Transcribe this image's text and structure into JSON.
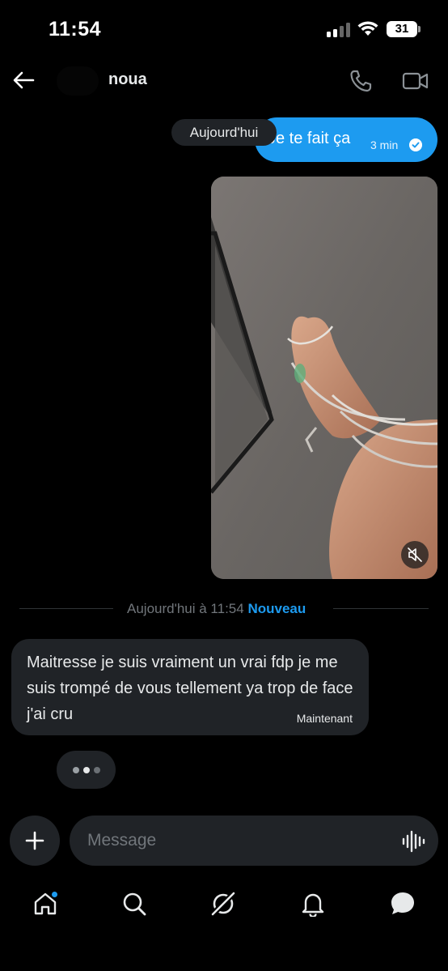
{
  "status_bar": {
    "time": "11:54",
    "battery": "31"
  },
  "header": {
    "contact_name": "noua",
    "icons": [
      "back-arrow-icon",
      "phone-icon",
      "video-camera-icon"
    ]
  },
  "conversation": {
    "date_pill": "Aujourd'hui",
    "outgoing_message": {
      "text": "Je te fait ça",
      "time": "3 min",
      "status_icon": "sent-check-icon"
    },
    "media_message": {
      "type": "video",
      "control_icon": "muted-speaker-icon"
    },
    "divider": {
      "label": "Aujourd'hui à 11:54",
      "badge": "Nouveau"
    },
    "incoming_message": {
      "text": "Maitresse je suis vraiment un vrai fdp je me suis trompé de vous tellement ya trop de face j'ai cru",
      "time": "Maintenant"
    },
    "typing_indicator": true
  },
  "composer": {
    "placeholder": "Message",
    "add_icon": "plus-icon",
    "voice_icon": "voice-wave-icon"
  },
  "tab_bar": {
    "items": [
      "home-icon",
      "search-icon",
      "grok-icon",
      "notifications-icon",
      "messages-icon"
    ],
    "home_has_unread": true
  },
  "colors": {
    "accent": "#1d9bf0",
    "bubble_dark": "#202327",
    "background": "#000000",
    "muted_text": "#71767b"
  }
}
